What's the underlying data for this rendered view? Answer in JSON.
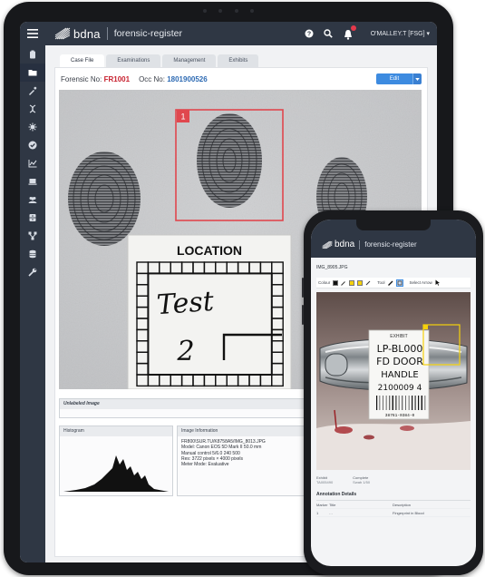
{
  "tablet": {
    "brand": {
      "name": "bdna",
      "app": "forensic-register"
    },
    "user": "O'MALLEY.T [FSG] ▾",
    "tabs": [
      {
        "label": "Case File",
        "active": true
      },
      {
        "label": "Examinations",
        "active": false
      },
      {
        "label": "Management",
        "active": false
      },
      {
        "label": "Exhibits",
        "active": false
      }
    ],
    "forensic_no_label": "Forensic No:",
    "forensic_no": "FR1001",
    "occ_no_label": "Occ No:",
    "occ_no": "1801900526",
    "edit_label": "Edit",
    "location_card": {
      "heading": "LOCATION",
      "line1": "Test",
      "line2": "2"
    },
    "marker_number": "1",
    "unlabeled_heading": "Unlabeled Image",
    "histogram_heading": "Histogram",
    "image_info_heading": "Image Information",
    "image_info_lines": [
      "FR800\\SUR.TU/K8758A5/IMG_8013.JPG",
      "Model: Canon EOS 5D Mark II 50.0 mm",
      "Manual control 5/6.0 240 500",
      "Res: 3722 pixels × 4000 pixels",
      "Meter Mode: Evaluative"
    ]
  },
  "phone": {
    "brand": {
      "name": "bdna",
      "app": "forensic-register"
    },
    "filename": "IMG_8905.JPG",
    "toolbar": {
      "colour_label": "Colour",
      "tool_label": "Tool",
      "select_label": "Select Arrow"
    },
    "exhibit_label": {
      "heading": "EXHIBIT",
      "line1": "LP-BL000",
      "line2": "FD DOOR",
      "line3": "HANDLE",
      "line4": "2100009   4",
      "barcode_number": "38761-0384-0"
    },
    "meta": [
      {
        "label": "Exhibit",
        "value": "TA005490"
      },
      {
        "label": "Complete",
        "value": "Swab 1/50"
      }
    ],
    "annotations_title": "Annotation Details",
    "annotation_headers": [
      "Marker",
      "Title",
      "Description"
    ],
    "annotation_rows": [
      {
        "marker": "1",
        "title": "…",
        "description": "Fingerprint in Blood"
      }
    ]
  },
  "colors": {
    "nav": "#2f3744",
    "accent": "#3d8be0",
    "marker_red": "#e0474e",
    "forensic_red": "#c8202e",
    "occ_blue": "#2d6ab3",
    "annotation_yellow": "#f5d10c"
  }
}
